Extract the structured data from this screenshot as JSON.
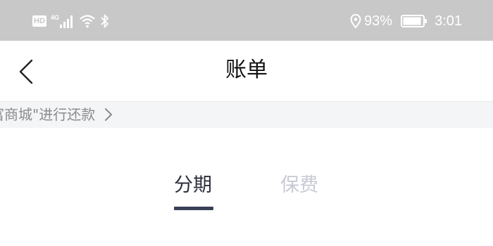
{
  "status_bar": {
    "hd_badge": "HD",
    "network": "4G",
    "battery_percent": "93%",
    "time": "3:01",
    "battery_level": 0.93
  },
  "nav": {
    "title": "账单"
  },
  "notice": {
    "text": "富商城\"进行还款"
  },
  "tabs": [
    {
      "label": "分期",
      "active": true
    },
    {
      "label": "保费",
      "active": false
    }
  ],
  "colors": {
    "status_bar_bg": "#c8c8c8",
    "active_tab": "#2b2f3b",
    "inactive_tab": "#c6cad3",
    "underline": "#3a4055"
  }
}
